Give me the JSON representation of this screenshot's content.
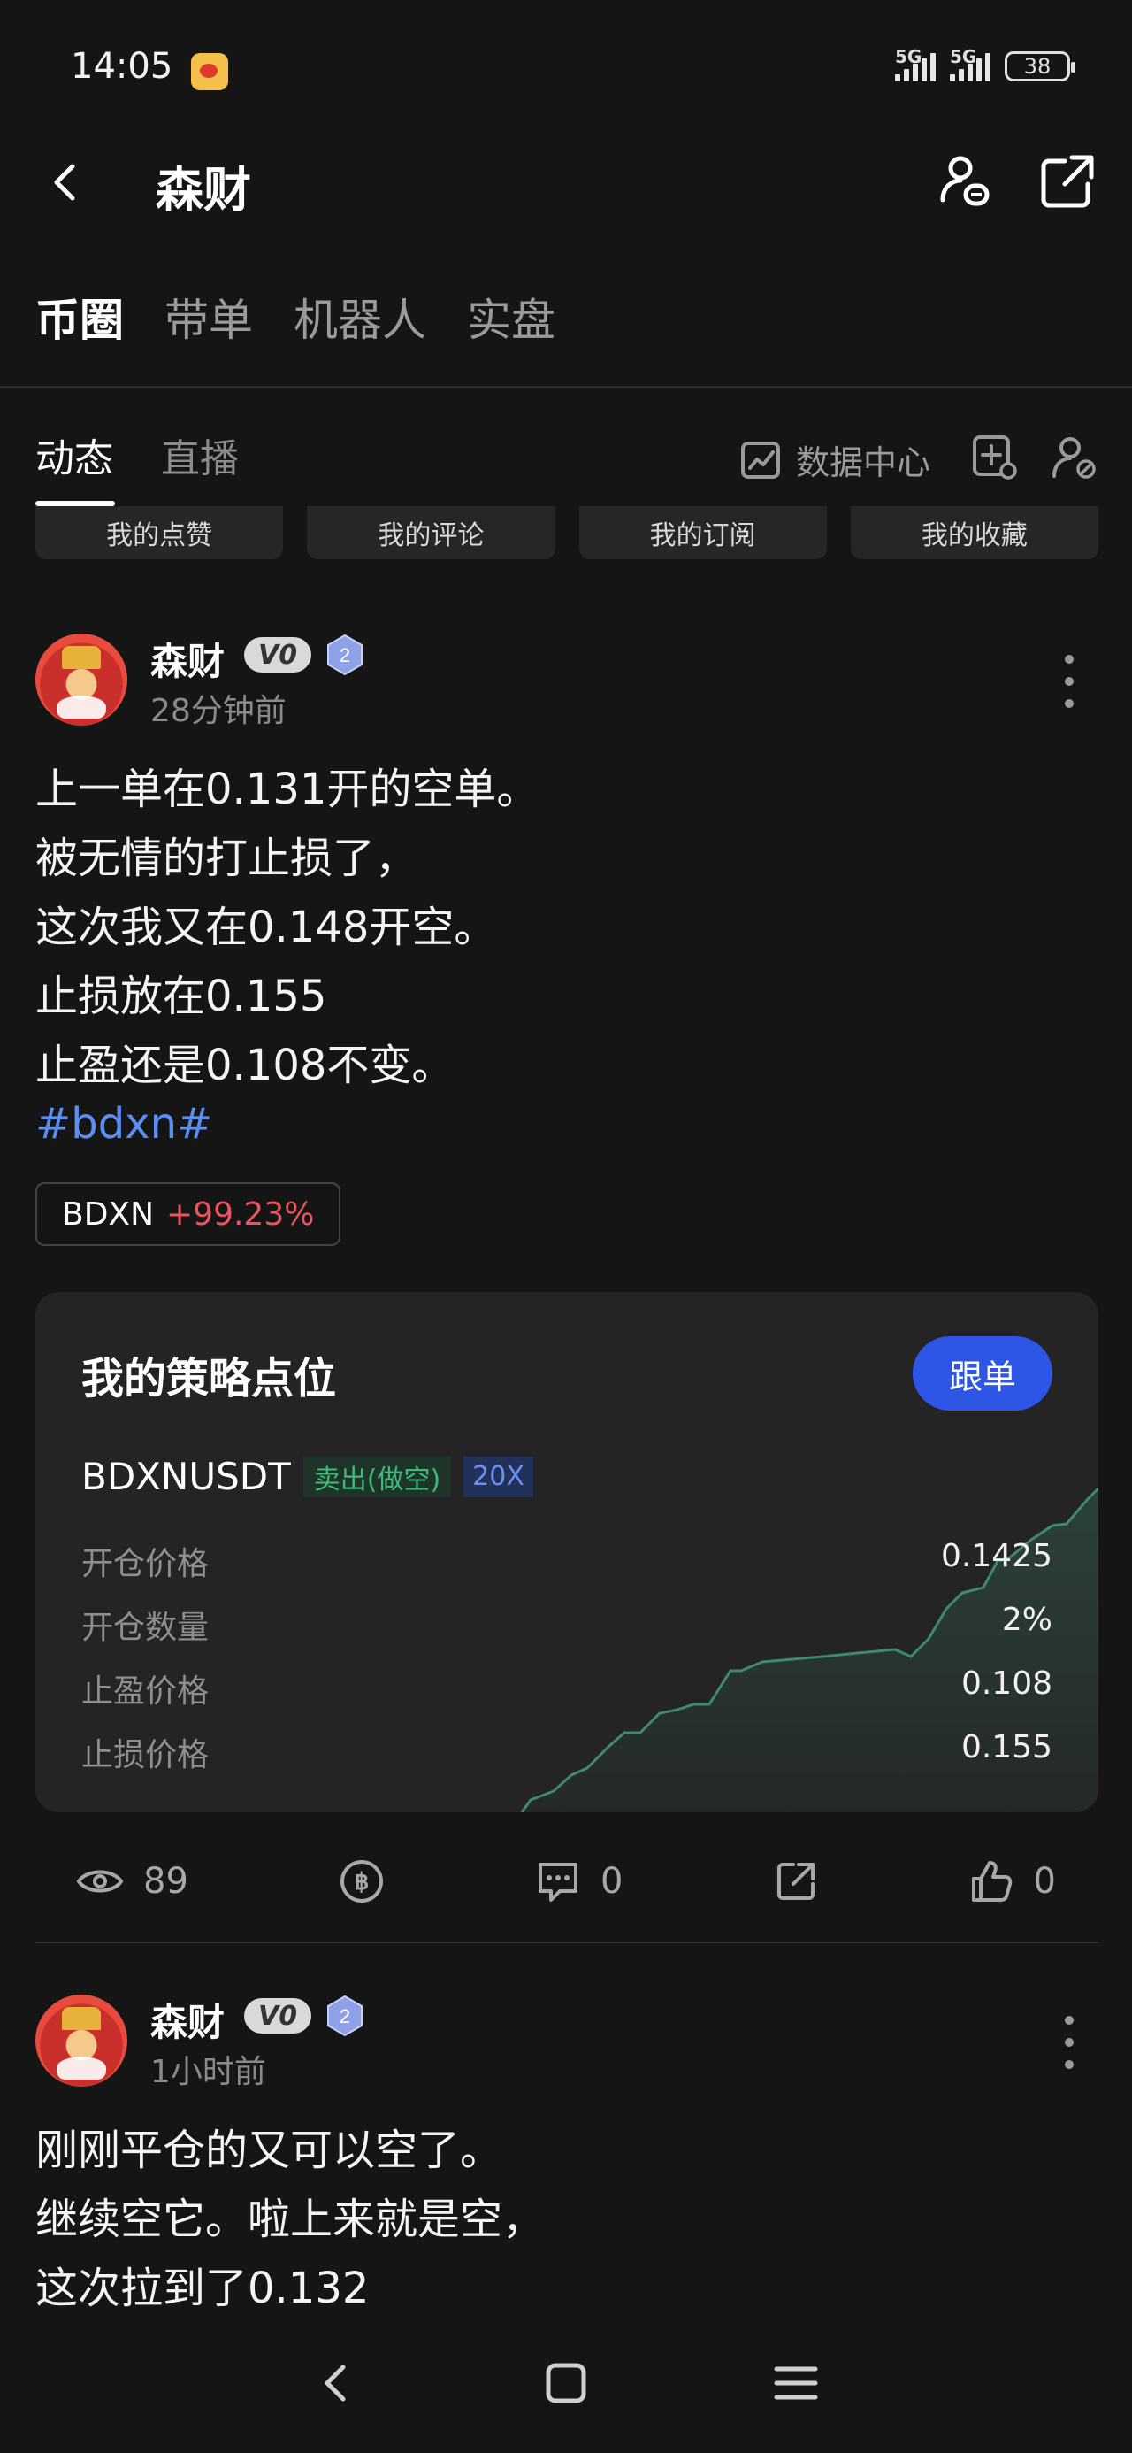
{
  "status_bar": {
    "time": "14:05",
    "signal1": "5G",
    "signal2": "5G",
    "battery": "38"
  },
  "header": {
    "title": "森财"
  },
  "category_tabs": [
    {
      "label": "币圈",
      "active": true
    },
    {
      "label": "带单",
      "active": false
    },
    {
      "label": "机器人",
      "active": false
    },
    {
      "label": "实盘",
      "active": false
    }
  ],
  "sub_tabs": [
    {
      "label": "动态",
      "active": true
    },
    {
      "label": "直播",
      "active": false
    }
  ],
  "data_center": "数据中心",
  "quick_buttons": [
    "我的点赞",
    "我的评论",
    "我的订阅",
    "我的收藏"
  ],
  "post1": {
    "username": "森财",
    "vip": "V0",
    "level": "2",
    "time": "28分钟前",
    "lines": [
      "上一单在0.131开的空单。",
      "被无情的打止损了，",
      "这次我又在0.148开空。",
      "止损放在0.155",
      "止盈还是0.108不变。"
    ],
    "hashtag": "#bdxn#",
    "coin": {
      "symbol": "BDXN",
      "change": "+99.23%"
    },
    "strategy": {
      "title": "我的策略点位",
      "follow_label": "跟单",
      "pair": "BDXNUSDT",
      "side": "卖出(做空)",
      "leverage": "20X",
      "rows": [
        {
          "key": "开仓价格",
          "value": "0.1425"
        },
        {
          "key": "开仓数量",
          "value": "2%"
        },
        {
          "key": "止盈价格",
          "value": "0.108"
        },
        {
          "key": "止损价格",
          "value": "0.155"
        }
      ]
    },
    "views": "89",
    "comments": "0",
    "likes": "0"
  },
  "post2": {
    "username": "森财",
    "vip": "V0",
    "level": "2",
    "time": "1小时前",
    "lines": [
      "刚刚平仓的又可以空了。",
      "继续空它。啦上来就是空，",
      "这次拉到了0.132"
    ]
  },
  "colors": {
    "background": "#151515",
    "accent_blue": "#2d55e6",
    "hashtag": "#5c8ef2",
    "up_red": "#e85560",
    "sell_green": "#3dbb7a"
  }
}
